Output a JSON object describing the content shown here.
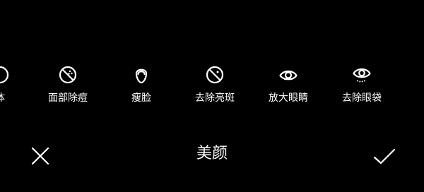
{
  "colors": {
    "background": "#000000",
    "foreground": "#ffffff"
  },
  "tools": [
    {
      "label": "体",
      "icon": "body-icon"
    },
    {
      "label": "面部除痘",
      "icon": "acne-removal-icon"
    },
    {
      "label": "瘦脸",
      "icon": "face-slim-icon"
    },
    {
      "label": "去除亮斑",
      "icon": "spot-removal-icon"
    },
    {
      "label": "放大眼睛",
      "icon": "eye-enlarge-icon"
    },
    {
      "label": "去除眼袋",
      "icon": "eye-bag-removal-icon"
    },
    {
      "label": "",
      "icon": "next-tool-icon"
    }
  ],
  "bottom_bar": {
    "title": "美颜",
    "close_icon": "close-icon",
    "confirm_icon": "checkmark-icon"
  }
}
